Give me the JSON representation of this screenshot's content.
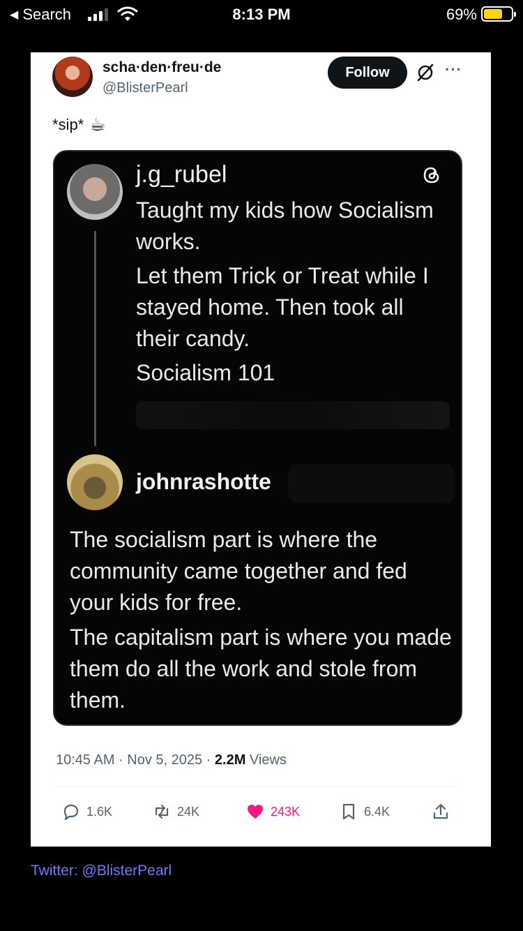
{
  "status_bar": {
    "back_label": "Search",
    "time": "8:13 PM",
    "battery_pct": "69%",
    "battery_level": 0.69,
    "battery_color": "#ffd60a"
  },
  "tweet": {
    "display_name": "scha·den·freu·de",
    "handle": "@BlisterPearl",
    "follow_label": "Follow",
    "text": "*sip*",
    "emoji": "☕",
    "timestamp": "10:45 AM · Nov 5, 2025 · ",
    "views_count": "2.2M",
    "views_label": " Views"
  },
  "embedded_image": {
    "post1": {
      "username": "j.g_rubel",
      "lines": [
        "Taught my kids how Socialism works.",
        "Let them Trick or Treat while I stayed home. Then took all their candy.",
        "Socialism 101"
      ]
    },
    "post2": {
      "username": "johnrashotte",
      "lines": [
        "The socialism part is where the community came together and fed your kids for free.",
        "The capitalism part is where you made them do all the work and stole from them."
      ]
    }
  },
  "actions": {
    "replies": "1.6K",
    "reposts": "24K",
    "likes": "243K",
    "bookmarks": "6.4K",
    "like_color": "#f91880"
  },
  "credit": "Twitter: @BlisterPearl"
}
